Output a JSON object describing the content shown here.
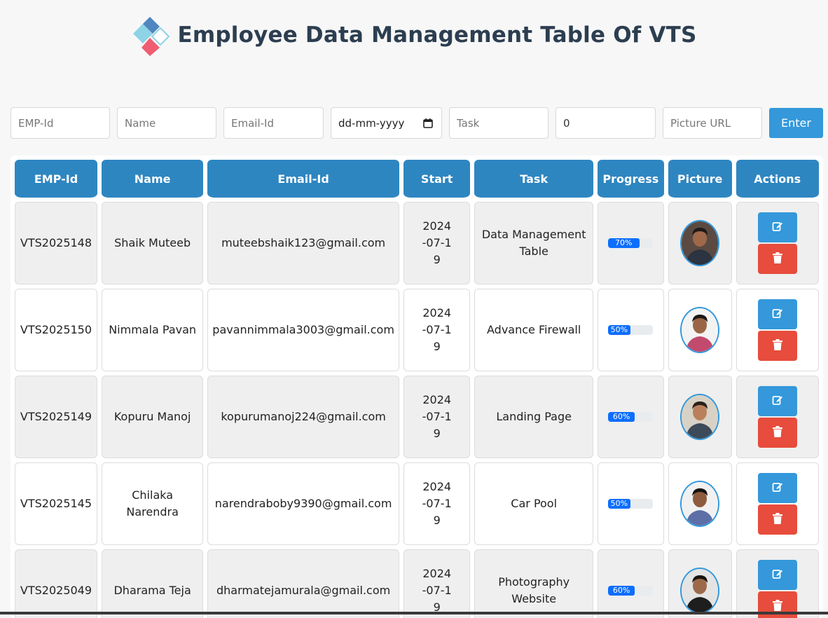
{
  "header": {
    "title": "Employee Data Management Table Of VTS"
  },
  "form": {
    "emp_id_placeholder": "EMP-Id",
    "name_placeholder": "Name",
    "email_placeholder": "Email-Id",
    "date_placeholder": "dd-mm-yyyy",
    "task_placeholder": "Task",
    "progress_value": "0",
    "picture_placeholder": "Picture URL",
    "enter_label": "Enter"
  },
  "table": {
    "headers": [
      "EMP-Id",
      "Name",
      "Email-Id",
      "Start",
      "Task",
      "Progress",
      "Picture",
      "Actions"
    ],
    "rows": [
      {
        "emp_id": "VTS2025148",
        "name": "Shaik Muteeb",
        "email": "muteebshaik123@gmail.com",
        "start": "2024-07-19",
        "task": "Data Management Table",
        "progress": 70,
        "progress_label": "70%"
      },
      {
        "emp_id": "VTS2025150",
        "name": "Nimmala Pavan",
        "email": "pavannimmala3003@gmail.com",
        "start": "2024-07-19",
        "task": "Advance Firewall",
        "progress": 50,
        "progress_label": "50%"
      },
      {
        "emp_id": "VTS2025149",
        "name": "Kopuru Manoj",
        "email": "kopurumanoj224@gmail.com",
        "start": "2024-07-19",
        "task": "Landing Page",
        "progress": 60,
        "progress_label": "60%"
      },
      {
        "emp_id": "VTS2025145",
        "name": "Chilaka Narendra",
        "email": "narendraboby9390@gmail.com",
        "start": "2024-07-19",
        "task": "Car Pool",
        "progress": 50,
        "progress_label": "50%"
      },
      {
        "emp_id": "VTS2025049",
        "name": "Dharama Teja",
        "email": "dharmatejamurala@gmail.com",
        "start": "2024-07-19",
        "task": "Photography Website",
        "progress": 60,
        "progress_label": "60%"
      }
    ]
  },
  "colors": {
    "accent": "#2e86c1",
    "button_blue": "#3498db",
    "delete_red": "#e74c3c",
    "progress_blue": "#0d6efd"
  },
  "icons": {
    "edit": "edit-icon",
    "delete": "trash-icon",
    "calendar": "calendar-icon",
    "logo": "diamond-logo"
  }
}
